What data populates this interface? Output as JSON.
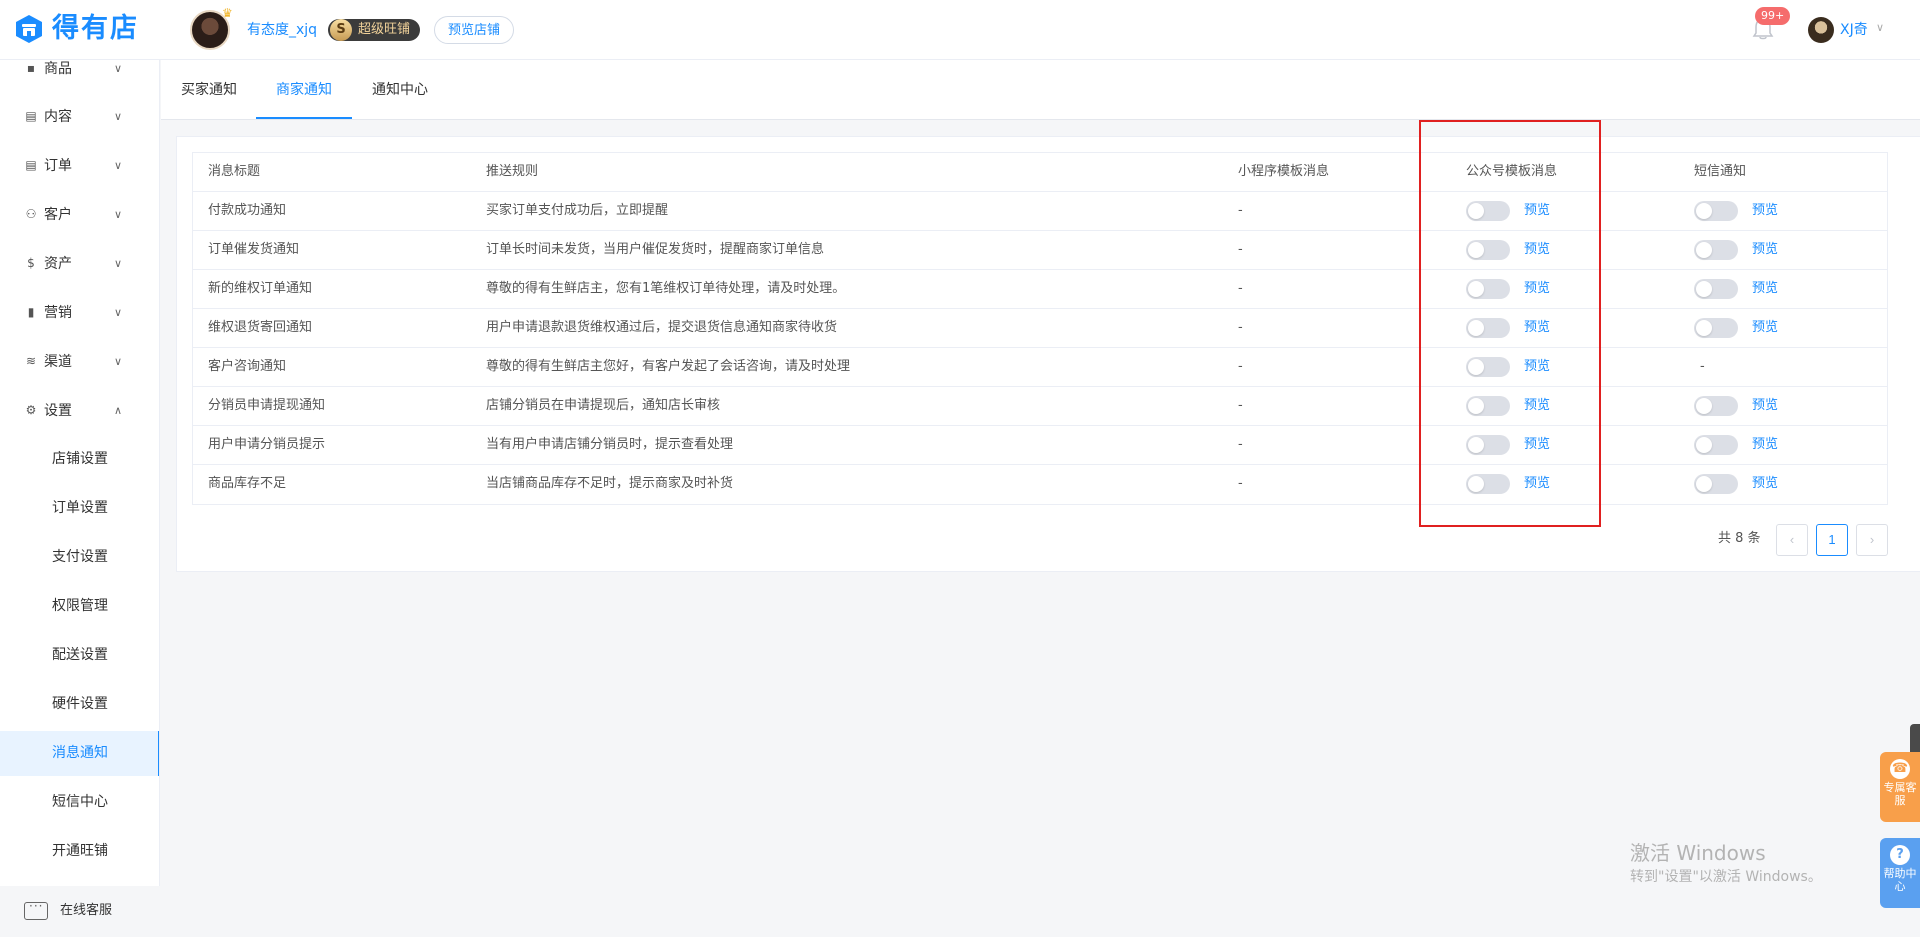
{
  "header": {
    "logo_text": "得有店",
    "shop_name": "有态度_xjq",
    "super_badge_icon": "S",
    "super_badge": "超级旺铺",
    "preview_shop": "预览店铺",
    "notification_count": "99+",
    "user_name": "XJ奇"
  },
  "sidebar": {
    "items": [
      {
        "icon": "goods-icon",
        "label": "商品"
      },
      {
        "icon": "content-icon",
        "label": "内容"
      },
      {
        "icon": "order-icon",
        "label": "订单"
      },
      {
        "icon": "customer-icon",
        "label": "客户"
      },
      {
        "icon": "asset-icon",
        "label": "资产"
      },
      {
        "icon": "marketing-icon",
        "label": "营销"
      },
      {
        "icon": "channel-icon",
        "label": "渠道"
      },
      {
        "icon": "settings-icon",
        "label": "设置"
      }
    ],
    "settings_children": [
      "店铺设置",
      "订单设置",
      "支付设置",
      "权限管理",
      "配送设置",
      "硬件设置",
      "消息通知",
      "短信中心",
      "开通旺铺"
    ],
    "active_child": "消息通知",
    "online_service": "在线客服"
  },
  "tabs": [
    "买家通知",
    "商家通知",
    "通知中心"
  ],
  "active_tab": "商家通知",
  "table": {
    "headers": [
      "消息标题",
      "推送规则",
      "小程序模板消息",
      "公众号模板消息",
      "短信通知"
    ],
    "preview_label": "预览",
    "dash": "-",
    "rows": [
      {
        "title": "付款成功通知",
        "rule": "买家订单支付成功后，立即提醒",
        "mini": "-",
        "wx_on": false,
        "sms_on": false,
        "sms_available": true
      },
      {
        "title": "订单催发货通知",
        "rule": "订单长时间未发货，当用户催促发货时，提醒商家订单信息",
        "mini": "-",
        "wx_on": false,
        "sms_on": false,
        "sms_available": true
      },
      {
        "title": "新的维权订单通知",
        "rule": "尊敬的得有生鲜店主，您有1笔维权订单待处理，请及时处理。",
        "mini": "-",
        "wx_on": false,
        "sms_on": false,
        "sms_available": true
      },
      {
        "title": "维权退货寄回通知",
        "rule": "用户申请退款退货维权通过后，提交退货信息通知商家待收货",
        "mini": "-",
        "wx_on": false,
        "sms_on": false,
        "sms_available": true
      },
      {
        "title": "客户咨询通知",
        "rule": "尊敬的得有生鲜店主您好，有客户发起了会话咨询，请及时处理",
        "mini": "-",
        "wx_on": false,
        "sms_on": false,
        "sms_available": false
      },
      {
        "title": "分销员申请提现通知",
        "rule": "店铺分销员在申请提现后，通知店长审核",
        "mini": "-",
        "wx_on": false,
        "sms_on": false,
        "sms_available": true
      },
      {
        "title": "用户申请分销员提示",
        "rule": "当有用户申请店铺分销员时，提示查看处理",
        "mini": "-",
        "wx_on": false,
        "sms_on": false,
        "sms_available": true
      },
      {
        "title": "商品库存不足",
        "rule": "当店铺商品库存不足时，提示商家及时补货",
        "mini": "-",
        "wx_on": false,
        "sms_on": false,
        "sms_available": true
      }
    ]
  },
  "pagination": {
    "total": "共 8 条",
    "prev": "‹",
    "current": "1",
    "next": "›"
  },
  "watermark": {
    "line1": "激活 Windows",
    "line2": "转到\"设置\"以激活 Windows。"
  },
  "float_buttons": {
    "customer_service": "专属客服",
    "help_icon": "?",
    "help": "帮助中心"
  },
  "colors": {
    "accent": "#1a8cff",
    "highlight": "#e02020",
    "toggle_off": "#dcdfe6"
  }
}
